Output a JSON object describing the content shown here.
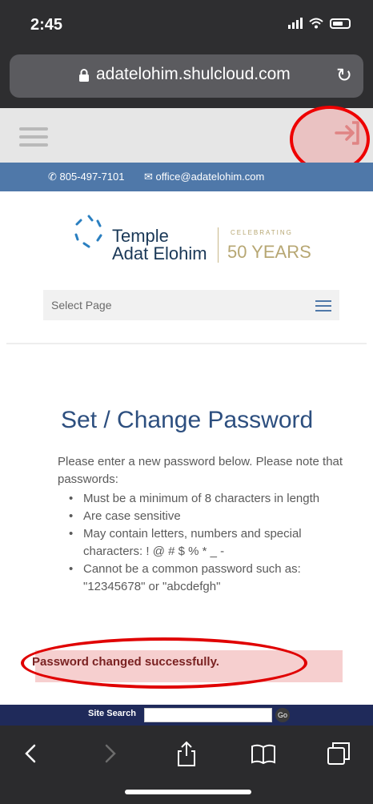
{
  "status_bar": {
    "time": "2:45"
  },
  "browser": {
    "url": "adatelohim.shulcloud.com"
  },
  "site": {
    "phone": "805-497-7101",
    "email": "office@adatelohim.com",
    "logo": {
      "name_line1": "Temple",
      "name_line2": "Adat Elohim",
      "celebrating": "CELEBRATING",
      "years": "50 YEARS"
    },
    "select_page": "Select Page"
  },
  "content": {
    "title": "Set / Change Password",
    "intro": "Please enter a new password below. Please note that passwords:",
    "requirements": [
      "Must be a minimum of 8 characters in length",
      "Are case sensitive",
      "May contain letters, numbers and special characters:   ! @ # $ % * _ -",
      "Cannot be a common password such as: \"12345678\" or \"abcdefgh\""
    ],
    "success_message": "Password changed successfully."
  },
  "footer": {
    "site_search_label": "Site Search",
    "go_label": "Go"
  },
  "icons": {
    "lock": "lock-icon",
    "reload": "reload-icon",
    "hamburger": "hamburger-icon",
    "login": "login-arrow-icon",
    "phone": "phone-icon",
    "email": "email-icon",
    "back": "back-icon",
    "forward": "forward-icon",
    "share": "share-icon",
    "bookmarks": "bookmarks-icon",
    "tabs": "tabs-icon"
  },
  "colors": {
    "contact_bar": "#4f78a9",
    "title": "#2d4f7f",
    "success_bg": "#f6cfcf",
    "annotation_red": "#e00000"
  }
}
